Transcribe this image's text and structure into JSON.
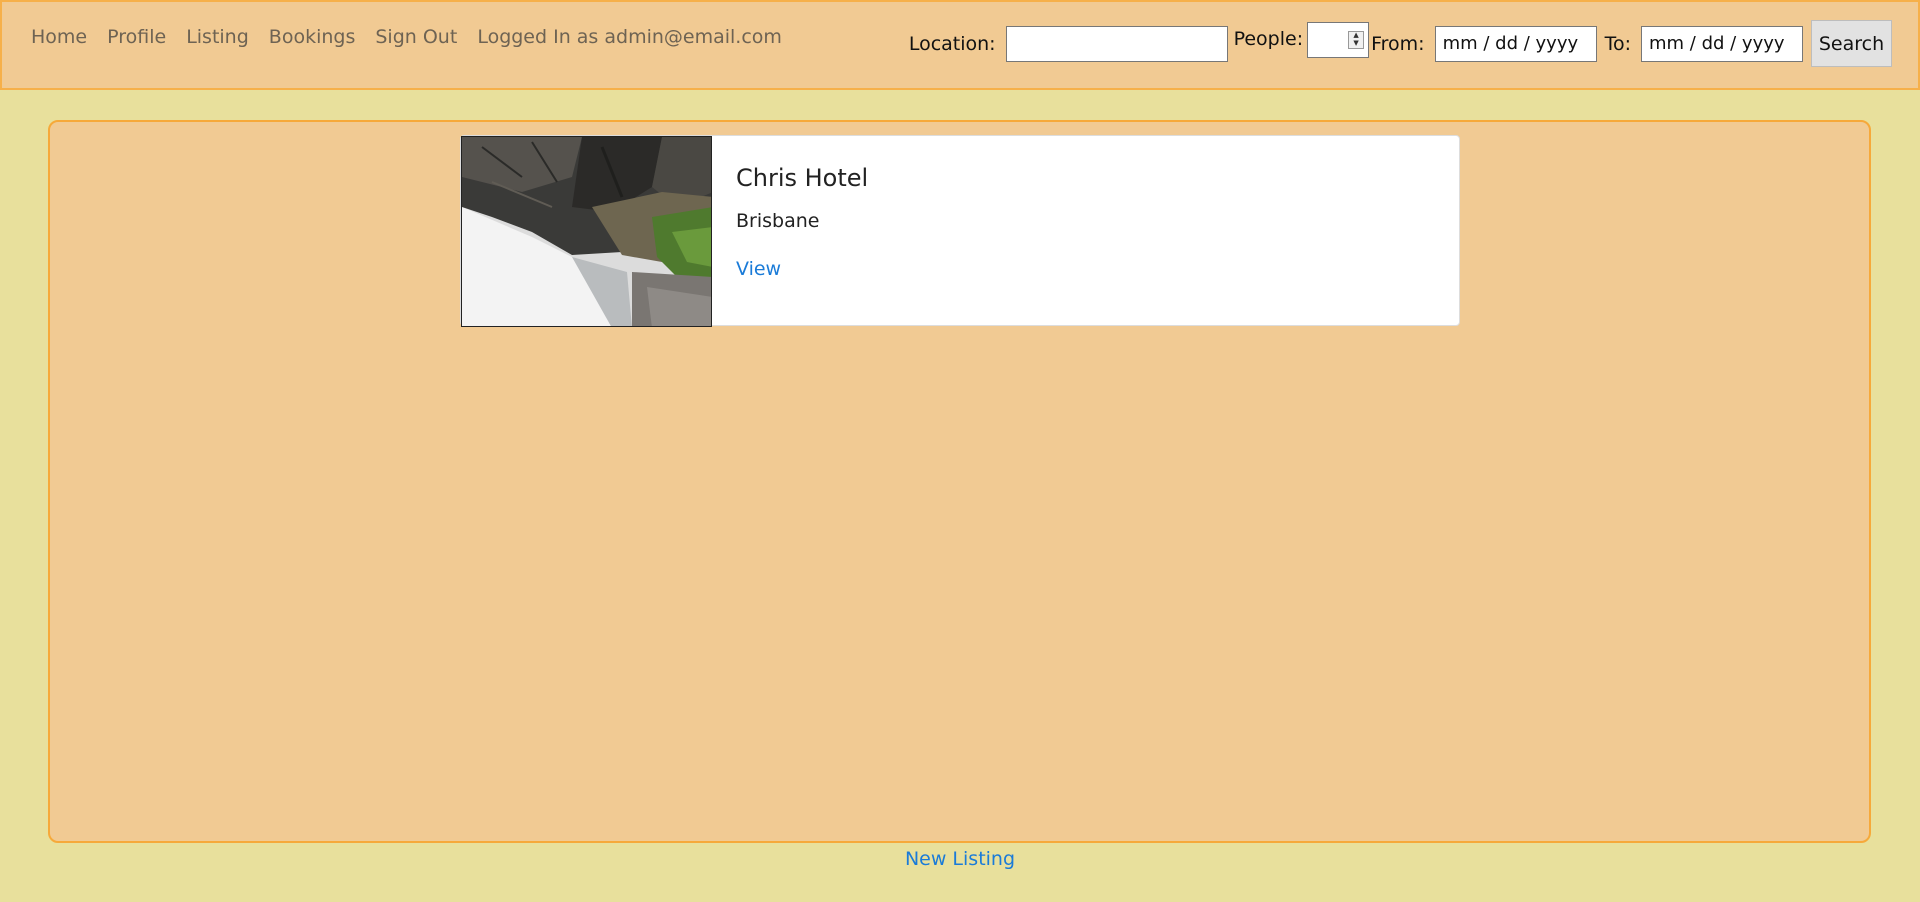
{
  "nav": {
    "links": [
      "Home",
      "Profile",
      "Listing",
      "Bookings",
      "Sign Out"
    ],
    "logged_in": "Logged In as admin@email.com"
  },
  "search": {
    "location_label": "Location:",
    "location_value": "",
    "people_label": "People:",
    "people_value": "",
    "from_label": "From:",
    "from_value": "mm / dd / yyyy",
    "to_label": "To:",
    "to_value": "mm / dd / yyyy",
    "button_label": "Search"
  },
  "listings": [
    {
      "title": "Chris Hotel",
      "location": "Brisbane",
      "link_label": "View",
      "image": "cliff-coast-photo"
    }
  ],
  "footer": {
    "new_listing_label": "New Listing"
  },
  "colors": {
    "page_bg": "#e8e09c",
    "panel_bg": "#f1ca93",
    "panel_border": "#f6a93a",
    "link": "#1a7bd8"
  }
}
